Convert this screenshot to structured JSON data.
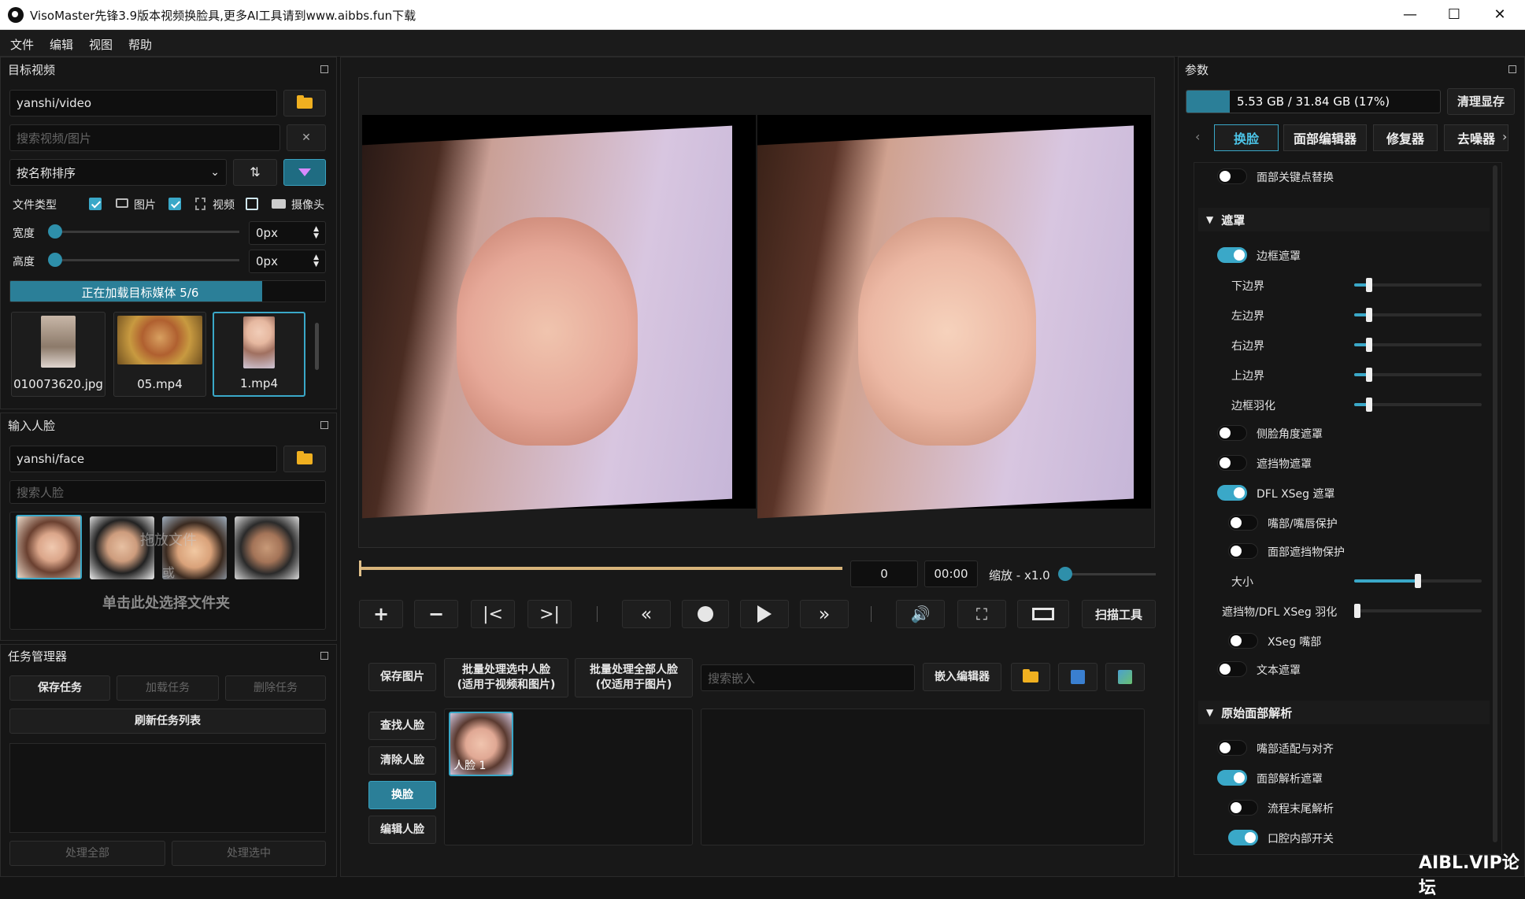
{
  "window": {
    "title": "VisoMaster先锋3.9版本视频换脸具,更多AI工具请到www.aibbs.fun下载",
    "minimize": "—",
    "maximize": "☐",
    "close": "✕"
  },
  "menu": [
    "文件",
    "编辑",
    "视图",
    "帮助"
  ],
  "target": {
    "title": "目标视频",
    "path": "yanshi/video",
    "search_placeholder": "搜索视频/图片",
    "clear": "✕",
    "sort": "按名称排序",
    "filetype_label": "文件类型",
    "image_label": "图片",
    "video_label": "视频",
    "camera_label": "摄像头",
    "image_checked": true,
    "video_checked": true,
    "camera_checked": false,
    "width_label": "宽度",
    "width_value": "0px",
    "height_label": "高度",
    "height_value": "0px",
    "loading": "正在加载目标媒体 5/6",
    "loading_progress": 0.8,
    "media": [
      {
        "name": "010073620.jpg"
      },
      {
        "name": "05.mp4"
      },
      {
        "name": "1.mp4"
      }
    ]
  },
  "input": {
    "title": "输入人脸",
    "path": "yanshi/face",
    "search_placeholder": "搜索人脸",
    "overlay_top": "拖放文件",
    "overlay_bottom": "或",
    "hint": "单击此处选择文件夹"
  },
  "tasks": {
    "title": "任务管理器",
    "save": "保存任务",
    "load": "加载任务",
    "delete": "删除任务",
    "refresh": "刷新任务列表",
    "process_all": "处理全部",
    "process_selected": "处理选中"
  },
  "player": {
    "frame": "0",
    "time": "00:00",
    "zoom": "缩放 - x1.0",
    "scan": "扫描工具",
    "progress": 0.0
  },
  "actions": {
    "save_image": "保存图片",
    "batch_selected": [
      "批量处理选中人脸",
      "(适用于视频和图片)"
    ],
    "batch_all": [
      "批量处理全部人脸",
      "(仅适用于图片)"
    ],
    "embed_placeholder": "搜索嵌入",
    "embed_editor": "嵌入编辑器",
    "find": "查找人脸",
    "clear": "清除人脸",
    "swap": "换脸",
    "edit": "编辑人脸",
    "face_label": "人脸 1"
  },
  "params": {
    "title": "参数",
    "vram": "5.53 GB / 31.84 GB (17%)",
    "vram_fraction": 0.17,
    "clear_vram": "清理显存",
    "tabs": [
      "换脸",
      "面部编辑器",
      "修复器",
      "去噪器"
    ],
    "items": [
      {
        "label": "面部关键点替换",
        "type": "toggle",
        "on": false,
        "indent": 0
      },
      {
        "label": "遮罩",
        "type": "section"
      },
      {
        "label": "边框遮罩",
        "type": "toggle",
        "on": true,
        "indent": 0
      },
      {
        "label": "下边界",
        "type": "slider",
        "value": 0.12
      },
      {
        "label": "左边界",
        "type": "slider",
        "value": 0.12
      },
      {
        "label": "右边界",
        "type": "slider",
        "value": 0.12
      },
      {
        "label": "上边界",
        "type": "slider",
        "value": 0.12
      },
      {
        "label": "边框羽化",
        "type": "slider",
        "value": 0.12
      },
      {
        "label": "侧脸角度遮罩",
        "type": "toggle",
        "on": false,
        "indent": 0
      },
      {
        "label": "遮挡物遮罩",
        "type": "toggle",
        "on": false,
        "indent": 0
      },
      {
        "label": "DFL XSeg 遮罩",
        "type": "toggle",
        "on": true,
        "indent": 0
      },
      {
        "label": "嘴部/嘴唇保护",
        "type": "toggle",
        "on": false,
        "indent": 1
      },
      {
        "label": "面部遮挡物保护",
        "type": "toggle",
        "on": false,
        "indent": 1
      },
      {
        "label": "大小",
        "type": "slider",
        "value": 0.5
      },
      {
        "label": "遮挡物/DFL XSeg 羽化",
        "type": "slider",
        "value": 0.02
      },
      {
        "label": "XSeg 嘴部",
        "type": "toggle",
        "on": false,
        "indent": 1
      },
      {
        "label": "文本遮罩",
        "type": "toggle",
        "on": false,
        "indent": 0
      },
      {
        "label": "原始面部解析",
        "type": "section"
      },
      {
        "label": "嘴部适配与对齐",
        "type": "toggle",
        "on": false,
        "indent": 0
      },
      {
        "label": "面部解析遮罩",
        "type": "toggle",
        "on": true,
        "indent": 0
      },
      {
        "label": "流程末尾解析",
        "type": "toggle",
        "on": false,
        "indent": 1
      },
      {
        "label": "口腔内部开关",
        "type": "toggle",
        "on": true,
        "indent": 1
      }
    ]
  },
  "watermark": "AIBL.VIP论坛",
  "colors": {
    "accent": "#2b8fae",
    "background": "#141414",
    "panel": "#161616"
  }
}
